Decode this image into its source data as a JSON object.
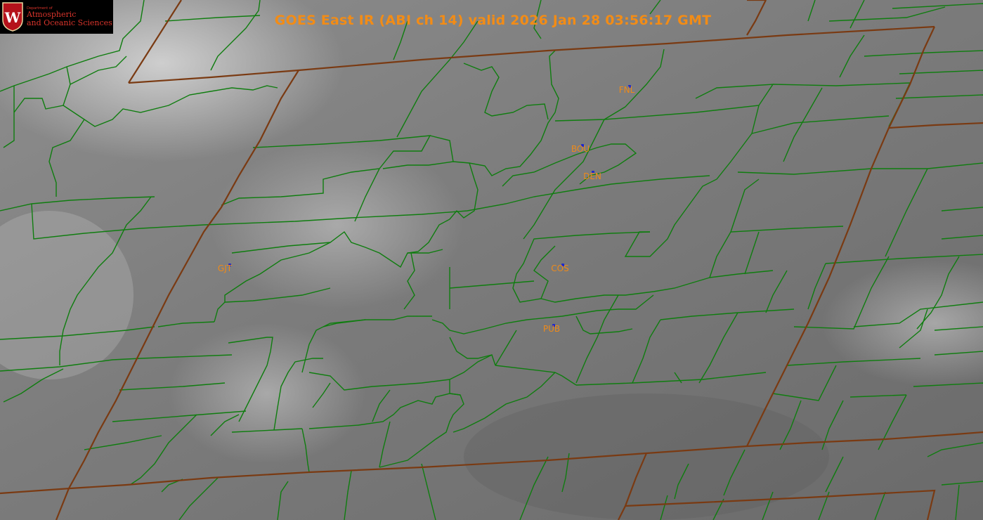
{
  "title": "GOES East IR (ABI ch 14) valid 2026 Jan 28 03:56:17 GMT",
  "logo": {
    "department": "Department of",
    "line1": "Atmospheric",
    "line2": "and Oceanic Sciences",
    "seal_letter": "W"
  },
  "stations": [
    {
      "id": "FNL",
      "label": "FNL"
    },
    {
      "id": "BOU",
      "label": "BOU"
    },
    {
      "id": "DEN",
      "label": "DEN"
    },
    {
      "id": "GJT",
      "label": "GJT"
    },
    {
      "id": "COS",
      "label": "COS"
    },
    {
      "id": "PUB",
      "label": "PUB"
    }
  ],
  "colors": {
    "county_lines": "#0f7d0f",
    "state_lines": "#7a3a12",
    "labels": "#f28c16",
    "station_dot": "#1c28d0",
    "logo_red": "#d9342b"
  }
}
